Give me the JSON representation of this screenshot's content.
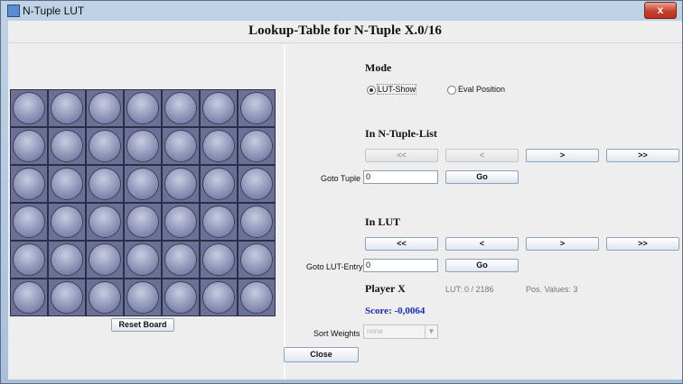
{
  "window": {
    "title": "N-Tuple LUT",
    "close_glyph": "x",
    "icon": "app-icon"
  },
  "heading": "Lookup-Table for N-Tuple X.0/16",
  "board": {
    "rows": 6,
    "cols": 7,
    "reset_label": "Reset Board"
  },
  "mode": {
    "title": "Mode",
    "options": [
      {
        "label": "LUT-Show",
        "selected": true
      },
      {
        "label": "Eval Position",
        "selected": false
      }
    ]
  },
  "ntuple_list": {
    "title": "In N-Tuple-List",
    "nav": [
      {
        "label": "<<",
        "enabled": false
      },
      {
        "label": "<",
        "enabled": false
      },
      {
        "label": ">",
        "enabled": true
      },
      {
        "label": ">>",
        "enabled": true
      }
    ],
    "goto_label": "Goto Tuple",
    "goto_value": "0",
    "go_label": "Go"
  },
  "lut": {
    "title": "In LUT",
    "nav": [
      {
        "label": "<<",
        "enabled": true
      },
      {
        "label": "<",
        "enabled": true
      },
      {
        "label": ">",
        "enabled": true
      },
      {
        "label": ">>",
        "enabled": true
      }
    ],
    "goto_label": "Goto LUT-Entry",
    "goto_value": "0",
    "go_label": "Go"
  },
  "player": {
    "title": "Player X",
    "lut_info": "LUT: 0 / 2186",
    "pos_values": "Pos. Values: 3",
    "score": "Score: -0,0064"
  },
  "sort": {
    "label": "Sort Weights",
    "value": "none"
  },
  "close_label": "Close"
}
